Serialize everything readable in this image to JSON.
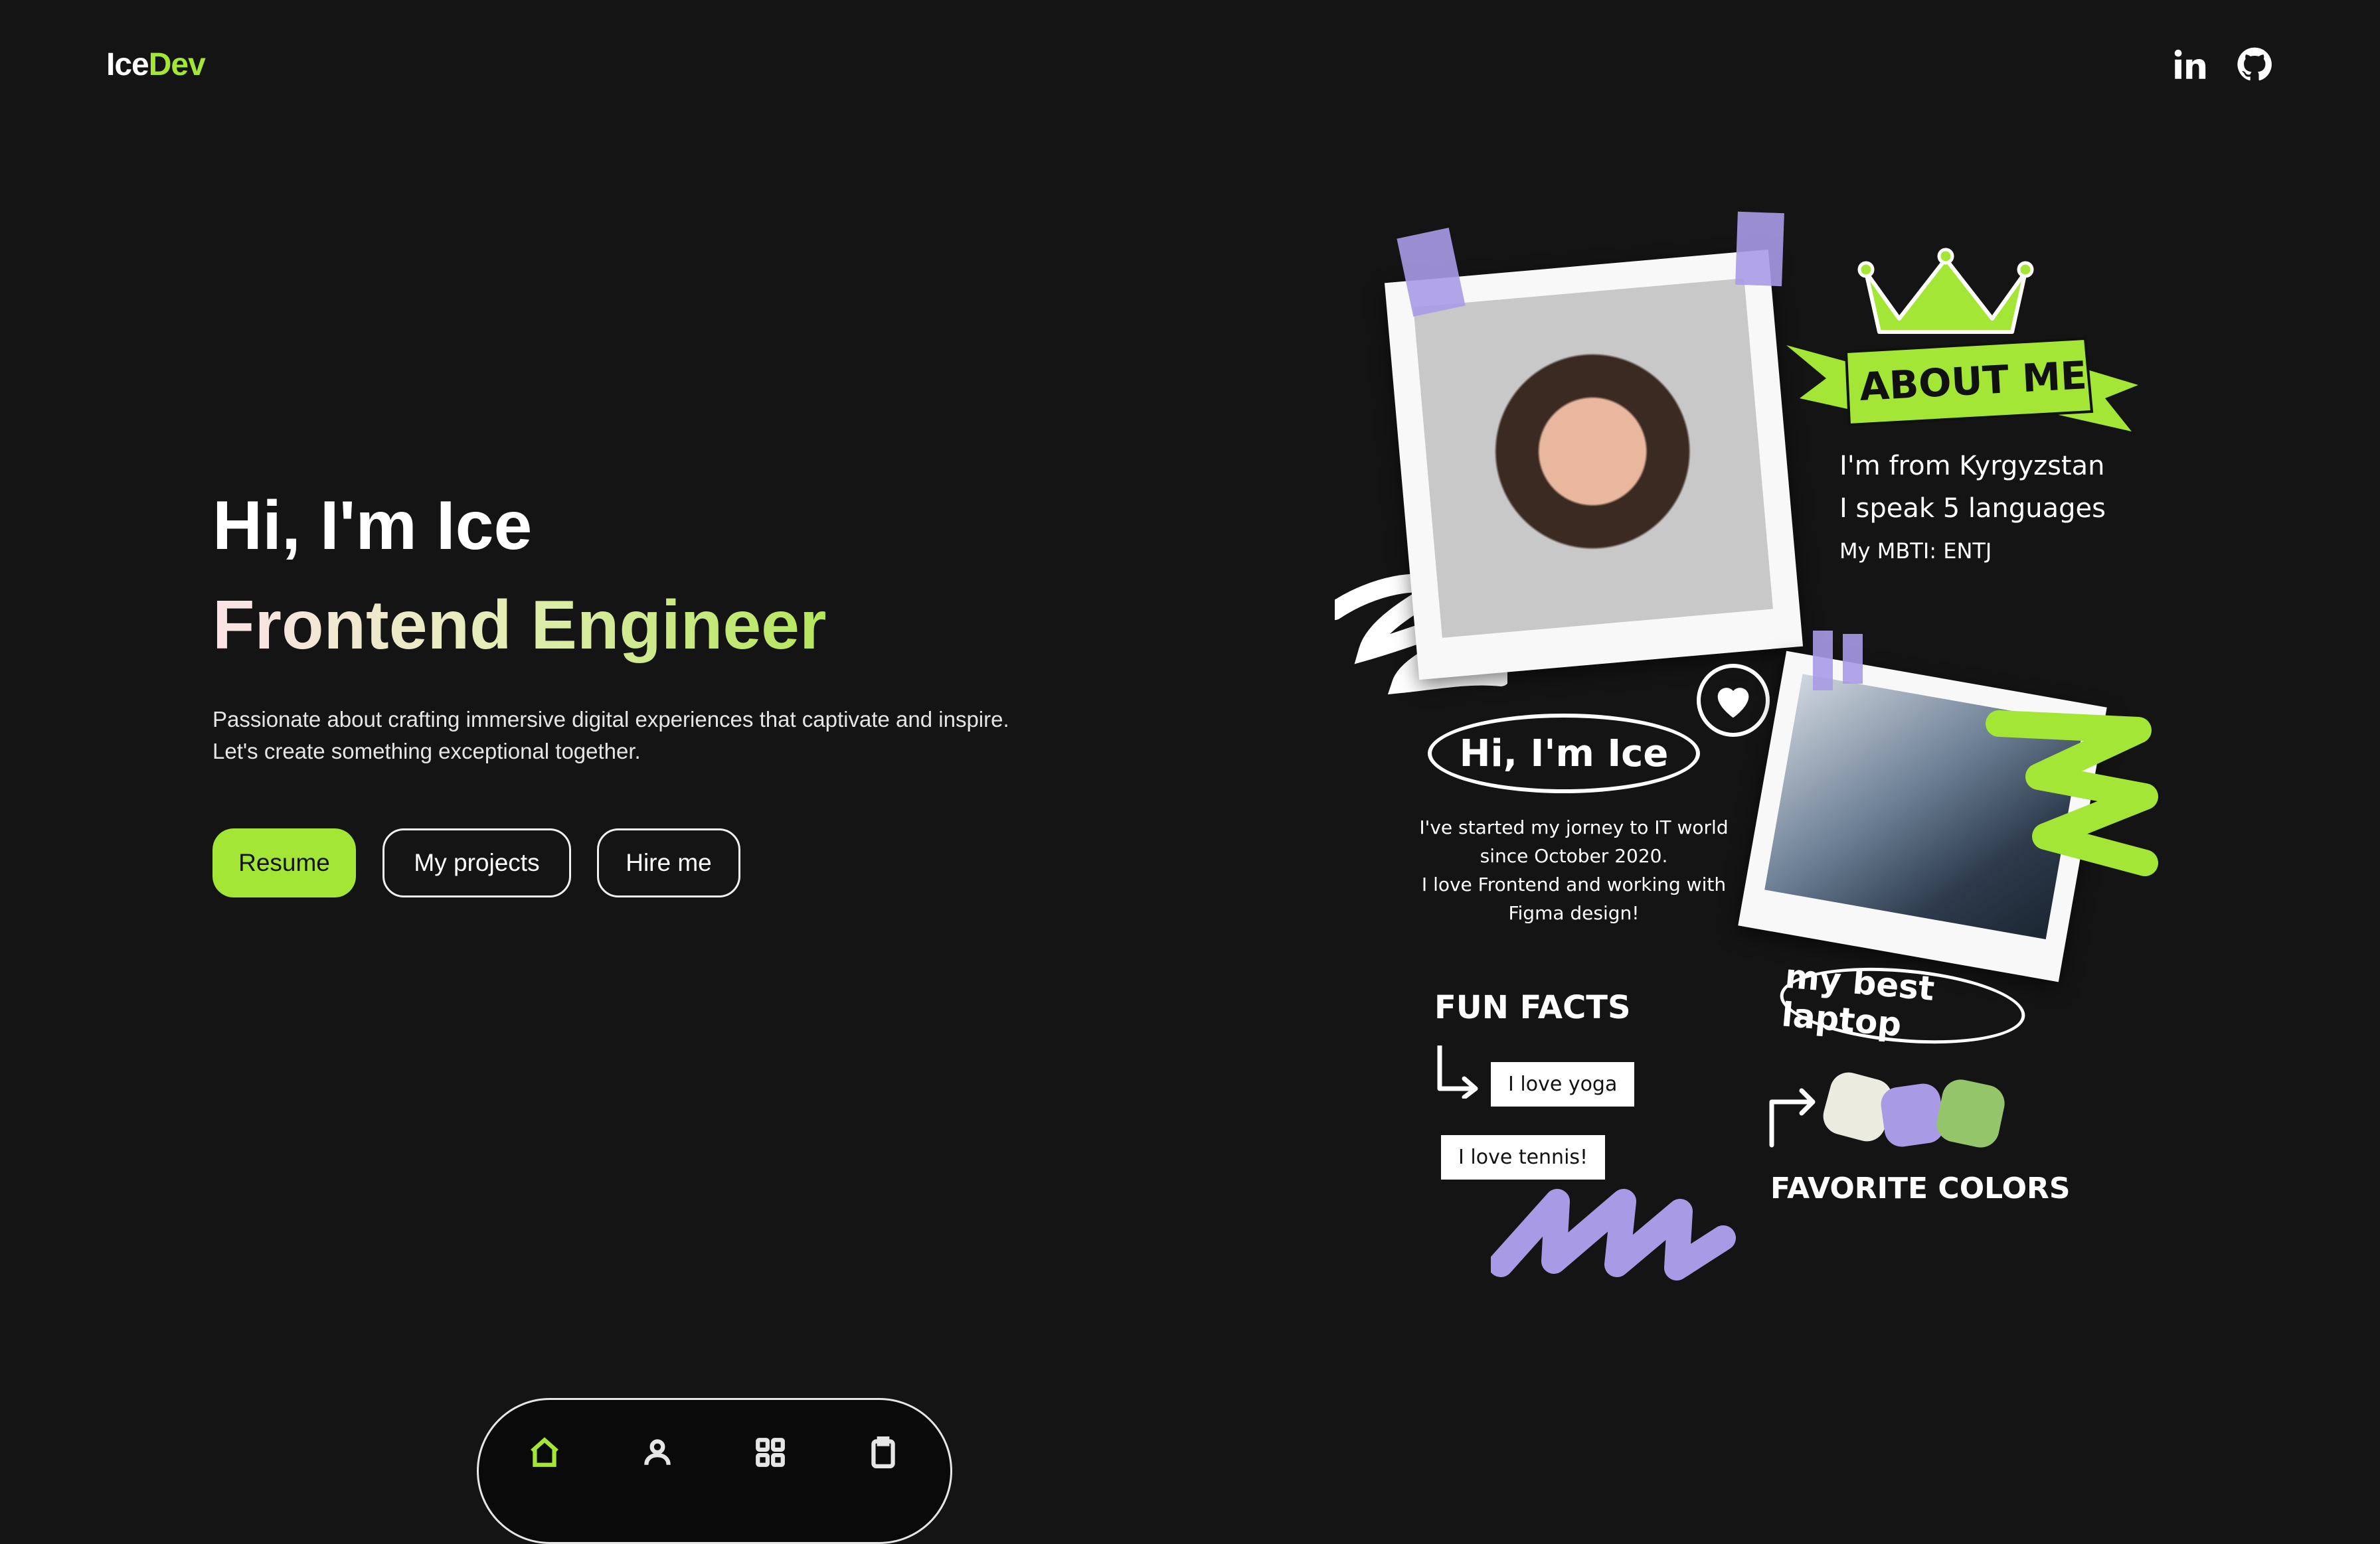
{
  "header": {
    "logo_part1": "Ice",
    "logo_part2": "Dev",
    "social": [
      {
        "icon": "linkedin-icon"
      },
      {
        "icon": "github-icon"
      }
    ]
  },
  "hero": {
    "greeting": "Hi, I'm Ice",
    "role": "Frontend Engineer",
    "description_line1": "Passionate about crafting immersive digital experiences that captivate and inspire.",
    "description_line2": "Let's create something exceptional together.",
    "buttons": {
      "resume": "Resume",
      "projects": "My projects",
      "hire": "Hire me"
    }
  },
  "collage": {
    "about_banner": "ABOUT ME",
    "about_lines": [
      "I'm from Kyrgyzstan",
      "I speak 5 languages",
      "My MBTI: ENTJ"
    ],
    "hi_bubble": "Hi, I'm Ice",
    "bio_lines": [
      "I've started my jorney to IT world",
      "since October 2020.",
      "I love Frontend and working with",
      "Figma design!"
    ],
    "laptop_label": "my best laptop",
    "fun_facts_title": "FUN FACTS",
    "fun_facts": [
      "I love yoga",
      "I love tennis!"
    ],
    "favorite_colors_title": "FAVORITE COLORS",
    "favorite_colors": [
      "#ecebe0",
      "#a99ae6",
      "#95c56a"
    ]
  },
  "dock": {
    "items": [
      {
        "icon": "home-icon",
        "active": true
      },
      {
        "icon": "user-icon",
        "active": false
      },
      {
        "icon": "grid-icon",
        "active": false
      },
      {
        "icon": "clipboard-icon",
        "active": false
      }
    ]
  },
  "colors": {
    "background": "#141414",
    "accent": "#a3e635",
    "purple": "#a99ae6"
  }
}
